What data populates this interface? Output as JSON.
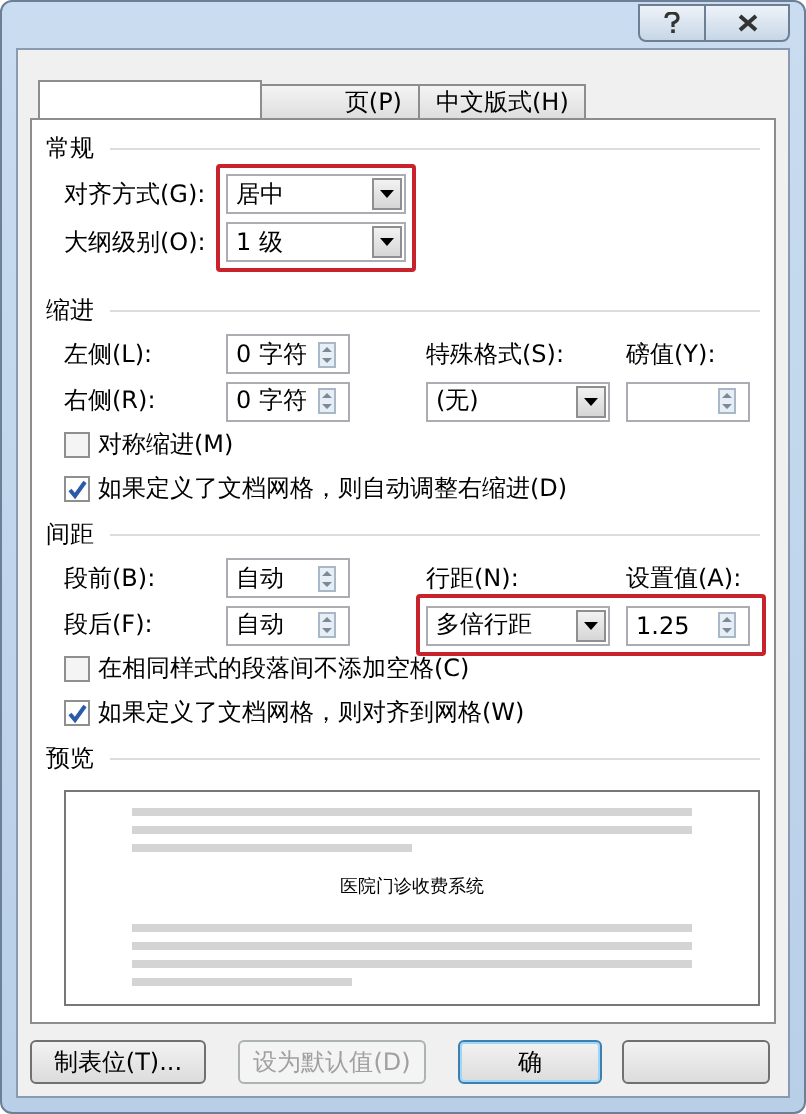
{
  "tabs": [
    {
      "selected": true
    },
    {
      "label": "页(P)",
      "selected": false
    },
    {
      "label": "中文版式(H)",
      "selected": false
    }
  ],
  "general": {
    "title": "常规",
    "highlighted": true,
    "fields": [
      {
        "label": "对齐方式(G):",
        "value": "居中"
      },
      {
        "label": "大纲级别(O):",
        "value": "1 级"
      }
    ]
  },
  "indent": {
    "title": "缩进",
    "left": {
      "label": "左侧(L):",
      "value": "0 字符"
    },
    "right": {
      "label": "右侧(R):",
      "value": "0 字符"
    },
    "special": {
      "label": "特殊格式(S):",
      "value": "(无)"
    },
    "by": {
      "label": "磅值(Y):"
    },
    "checkboxes": [
      {
        "label": "对称缩进(M)",
        "checked": false
      },
      {
        "label": "如果定义了文档网格，则自动调整右缩进(D)",
        "checked": true
      }
    ]
  },
  "spacing": {
    "title": "间距",
    "highlighted": true,
    "before": {
      "label": "段前(B):",
      "value": "自动"
    },
    "after": {
      "label": "段后(F):",
      "value": "自动"
    },
    "line_spacing": {
      "label": "行距(N):",
      "value": "多倍行距"
    },
    "at": {
      "label": "设置值(A):",
      "value": "1.25"
    },
    "checkboxes": [
      {
        "label": "在相同样式的段落间不添加空格(C)",
        "checked": false
      },
      {
        "label": "如果定义了文档网格，则对齐到网格(W)",
        "checked": true
      }
    ]
  },
  "preview": {
    "title": "预览",
    "sample": "医院门诊收费系统"
  },
  "buttons": [
    {
      "label": "制表位(T)...",
      "disabled": false,
      "default": false
    },
    {
      "label": "设为默认值(D)",
      "disabled": true,
      "default": false
    },
    {
      "label": "确",
      "disabled": false,
      "default": true
    },
    {
      "disabled": false,
      "default": false
    }
  ]
}
